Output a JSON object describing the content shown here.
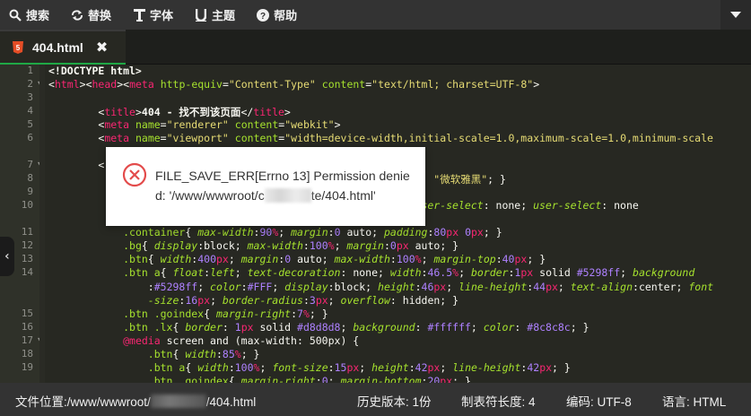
{
  "toolbar": {
    "search": "搜索",
    "replace": "替换",
    "font": "字体",
    "theme": "主题",
    "help": "帮助"
  },
  "tab": {
    "filename": "404.html",
    "close": "✖"
  },
  "editor": {
    "line_numbers": [
      "1",
      "2",
      "3",
      "4",
      "5",
      "6",
      "7",
      "8",
      "9",
      "10",
      "11",
      "12",
      "13",
      "14",
      "",
      "15",
      "16",
      "17",
      "18",
      "19"
    ]
  },
  "dialog": {
    "message_prefix": "FILE_SAVE_ERR[Errno 13] Permission denied: '/www/wwwroot/c",
    "message_suffix": "te/404.html'"
  },
  "statusbar": {
    "path_label": "文件位置:",
    "path_prefix": "/www/wwwroot/",
    "path_suffix": "/404.html",
    "history_label": "历史版本:",
    "history_value": "1份",
    "tab_label": "制表符长度:",
    "tab_value": "4",
    "encoding_label": "编码:",
    "encoding_value": "UTF-8",
    "lang_label": "语言:",
    "lang_value": "HTML"
  },
  "colors": {
    "accent": "#1fa845",
    "error": "#e34b4b",
    "html5": "#e44d26"
  }
}
